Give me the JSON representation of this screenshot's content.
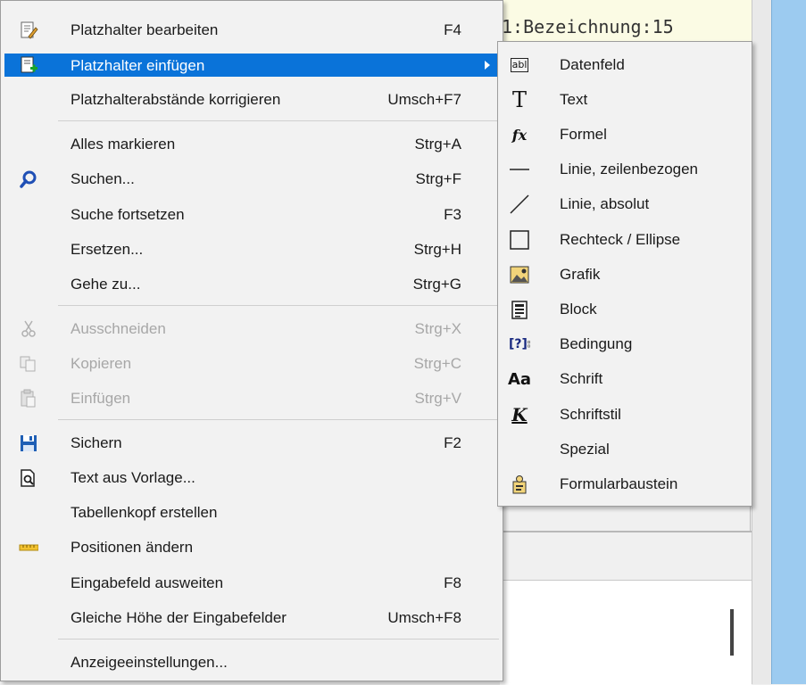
{
  "background": {
    "code_text": "1:Bezeichnung:15"
  },
  "main_menu": {
    "items": [
      {
        "label": "Platzhalter bearbeiten",
        "shortcut": "F4",
        "icon": "edit-placeholder-icon",
        "disabled": false
      },
      {
        "label": "Platzhalter einfügen",
        "shortcut": "",
        "icon": "insert-placeholder-icon",
        "disabled": false,
        "highlighted": true,
        "submenu": true
      },
      {
        "label": "Platzhalterabstände korrigieren",
        "shortcut": "Umsch+F7",
        "icon": "",
        "disabled": false
      },
      {
        "label": "Alles markieren",
        "shortcut": "Strg+A",
        "icon": "",
        "disabled": false
      },
      {
        "label": "Suchen...",
        "shortcut": "Strg+F",
        "icon": "search-icon",
        "disabled": false
      },
      {
        "label": "Suche fortsetzen",
        "shortcut": "F3",
        "icon": "",
        "disabled": false
      },
      {
        "label": "Ersetzen...",
        "shortcut": "Strg+H",
        "icon": "",
        "disabled": false
      },
      {
        "label": "Gehe zu...",
        "shortcut": "Strg+G",
        "icon": "",
        "disabled": false
      },
      {
        "label": "Ausschneiden",
        "shortcut": "Strg+X",
        "icon": "cut-icon",
        "disabled": true
      },
      {
        "label": "Kopieren",
        "shortcut": "Strg+C",
        "icon": "copy-icon",
        "disabled": true
      },
      {
        "label": "Einfügen",
        "shortcut": "Strg+V",
        "icon": "paste-icon",
        "disabled": true
      },
      {
        "label": "Sichern",
        "shortcut": "F2",
        "icon": "save-icon",
        "disabled": false
      },
      {
        "label": "Text aus Vorlage...",
        "shortcut": "",
        "icon": "document-search-icon",
        "disabled": false
      },
      {
        "label": "Tabellenkopf erstellen",
        "shortcut": "",
        "icon": "",
        "disabled": false
      },
      {
        "label": "Positionen ändern",
        "shortcut": "",
        "icon": "ruler-icon",
        "disabled": false
      },
      {
        "label": "Eingabefeld ausweiten",
        "shortcut": "F8",
        "icon": "",
        "disabled": false
      },
      {
        "label": "Gleiche Höhe der Eingabefelder",
        "shortcut": "Umsch+F8",
        "icon": "",
        "disabled": false
      },
      {
        "label": "Anzeigeeinstellungen...",
        "shortcut": "",
        "icon": "",
        "disabled": false
      }
    ]
  },
  "submenu": {
    "items": [
      {
        "label": "Datenfeld",
        "icon": "data-field-icon"
      },
      {
        "label": "Text",
        "icon": "text-t-icon"
      },
      {
        "label": "Formel",
        "icon": "formula-fx-icon"
      },
      {
        "label": "Linie, zeilenbezogen",
        "icon": "horizontal-line-icon"
      },
      {
        "label": "Linie, absolut",
        "icon": "diagonal-line-icon"
      },
      {
        "label": "Rechteck / Ellipse",
        "icon": "rectangle-icon"
      },
      {
        "label": "Grafik",
        "icon": "image-icon"
      },
      {
        "label": "Block",
        "icon": "block-icon"
      },
      {
        "label": "Bedingung",
        "icon": "condition-icon"
      },
      {
        "label": "Schrift",
        "icon": "font-aa-icon"
      },
      {
        "label": "Schriftstil",
        "icon": "font-style-icon"
      },
      {
        "label": "Spezial",
        "icon": ""
      },
      {
        "label": "Formularbaustein",
        "icon": "form-module-icon"
      }
    ],
    "icon_glyphs": {
      "text_t": "T",
      "formula": "fx",
      "data_field": "abl",
      "condition": "[?]",
      "font": "Aa",
      "style": "K"
    }
  },
  "colors": {
    "highlight": "#0a73d9",
    "disabled_text": "#a7a7a7",
    "menu_bg": "#f2f2f2"
  }
}
